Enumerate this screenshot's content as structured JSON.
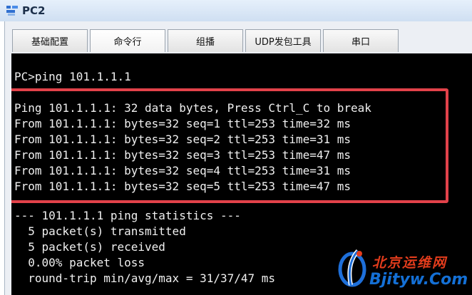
{
  "window": {
    "title": "PC2"
  },
  "tabs": [
    {
      "label": "基础配置"
    },
    {
      "label": "命令行"
    },
    {
      "label": "组播"
    },
    {
      "label": "UDP发包工具"
    },
    {
      "label": "串口"
    }
  ],
  "terminal": {
    "lines": [
      "PC>ping 101.1.1.1",
      "",
      "Ping 101.1.1.1: 32 data bytes, Press Ctrl_C to break",
      "From 101.1.1.1: bytes=32 seq=1 ttl=253 time=32 ms",
      "From 101.1.1.1: bytes=32 seq=2 ttl=253 time=31 ms",
      "From 101.1.1.1: bytes=32 seq=3 ttl=253 time=47 ms",
      "From 101.1.1.1: bytes=32 seq=4 ttl=253 time=31 ms",
      "From 101.1.1.1: bytes=32 seq=5 ttl=253 time=47 ms",
      "",
      "--- 101.1.1.1 ping statistics ---",
      "  5 packet(s) transmitted",
      "  5 packet(s) received",
      "  0.00% packet loss",
      "  round-trip min/avg/max = 31/37/47 ms"
    ]
  },
  "watermark": {
    "site_name": "北京运维网",
    "url": "Bjityw.Com"
  },
  "colors": {
    "highlight_border": "#e2424a",
    "terminal_bg": "#000000",
    "terminal_text": "#f0f0f0"
  },
  "icons": {
    "app": "ensp-pc-icon",
    "watermark": "watermark-logo-icon"
  }
}
